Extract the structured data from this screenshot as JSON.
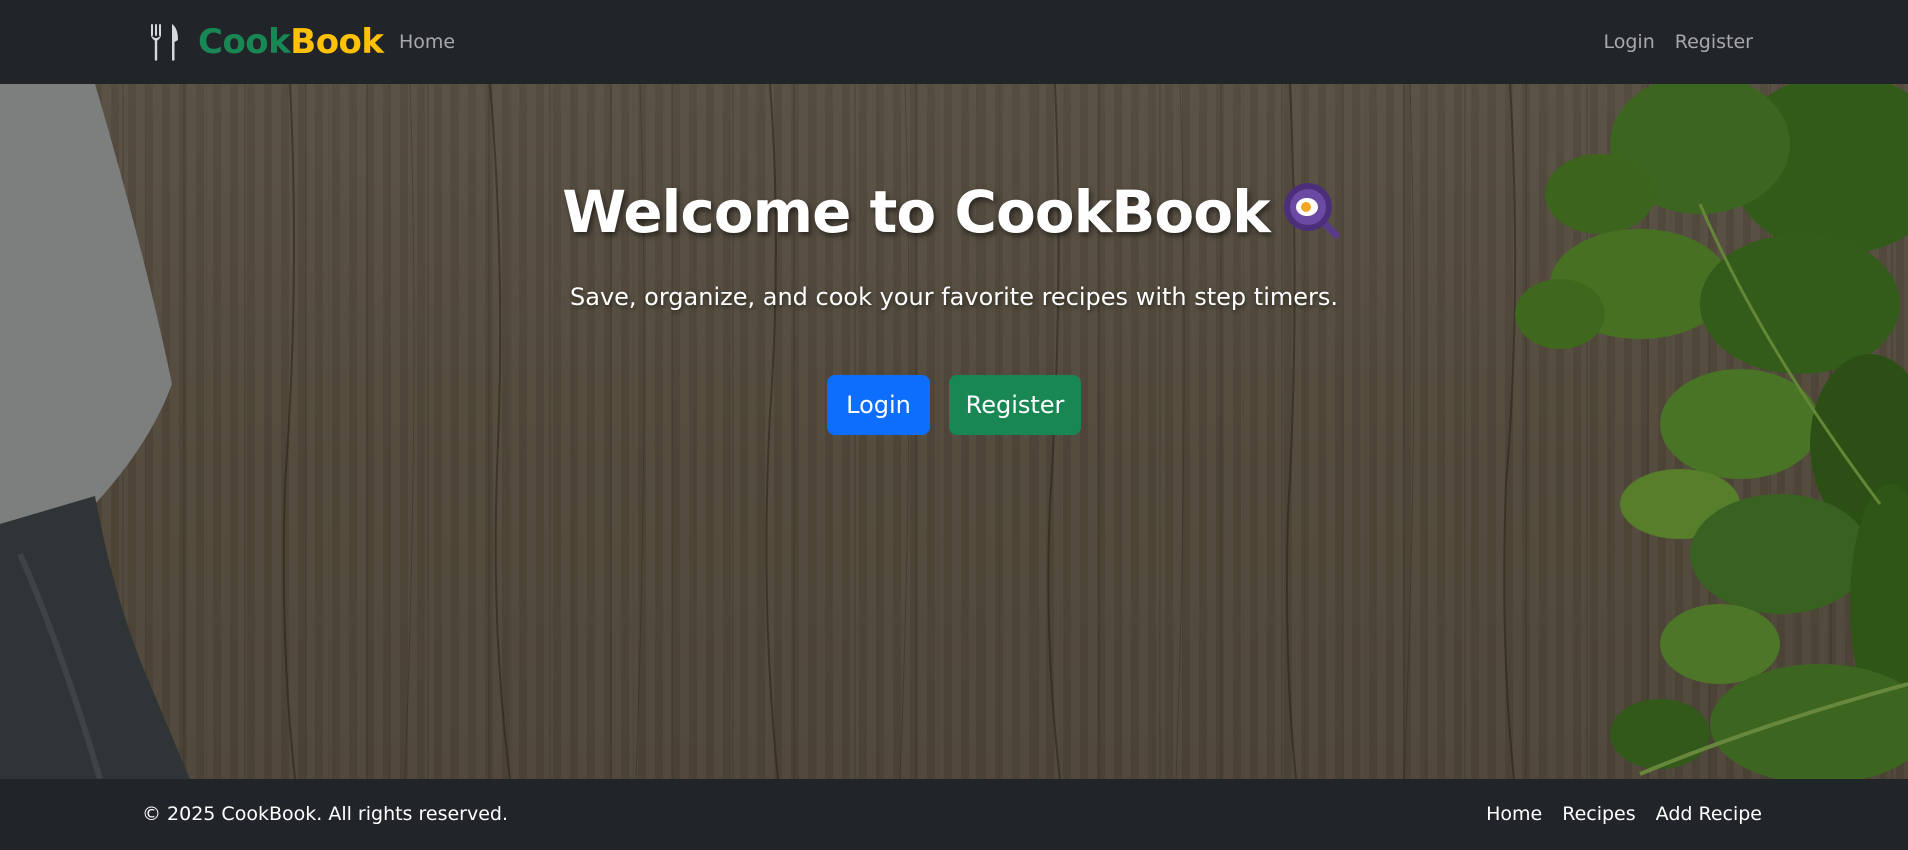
{
  "navbar": {
    "brand_part1": "Cook",
    "brand_part2": "Book",
    "brand_icon": "fork-knife-icon",
    "home_label": "Home",
    "login_label": "Login",
    "register_label": "Register"
  },
  "hero": {
    "title": "Welcome to CookBook",
    "title_icon": "frying-pan-egg-icon",
    "subtitle": "Save, organize, and cook your favorite recipes with step timers.",
    "login_button": "Login",
    "register_button": "Register"
  },
  "footer": {
    "copyright": "© 2025 CookBook. All rights reserved.",
    "links": [
      "Home",
      "Recipes",
      "Add Recipe"
    ]
  },
  "colors": {
    "navbar_bg": "#212529",
    "brand_cook": "#198754",
    "brand_book": "#ffc107",
    "primary_button": "#0d6efd",
    "success_button": "#198754"
  }
}
